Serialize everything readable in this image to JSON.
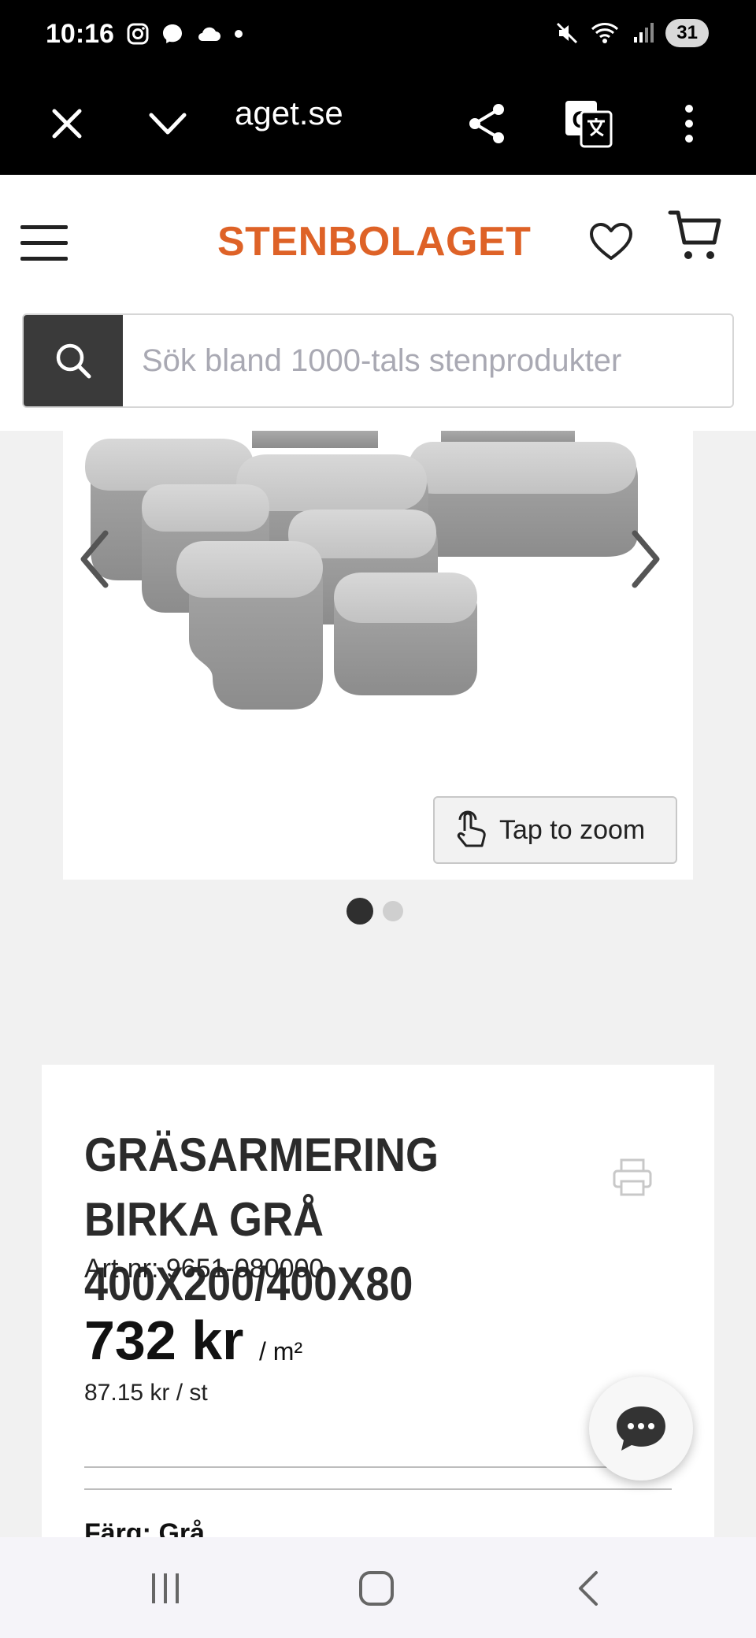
{
  "status_bar": {
    "time": "10:16",
    "battery": "31",
    "icons_left": [
      "instagram-icon",
      "messenger-icon",
      "cloud-icon",
      "dot-icon"
    ],
    "icons_right": [
      "mute-icon",
      "wifi-icon",
      "signal-icon",
      "battery-icon"
    ]
  },
  "browser": {
    "url": "aget.se",
    "icons": [
      "close-icon",
      "chevron-down-icon",
      "share-icon",
      "translate-icon",
      "more-icon"
    ]
  },
  "header": {
    "logo": "STENBOLAGET",
    "brand_color": "#de6227",
    "search_placeholder": "Sök bland 1000-tals stenprodukter"
  },
  "gallery": {
    "zoom_label": "Tap to zoom",
    "slide_count": 2,
    "active_slide": 1
  },
  "product": {
    "title": "GRÄSARMERING BIRKA GRÅ 400X200/400X80",
    "art_nr": "Art-nr: 9651-080000",
    "price": "732 kr",
    "unit": "/ m²",
    "price_per_piece": "87.15 kr / st",
    "color_label": "Färg: Grå"
  }
}
